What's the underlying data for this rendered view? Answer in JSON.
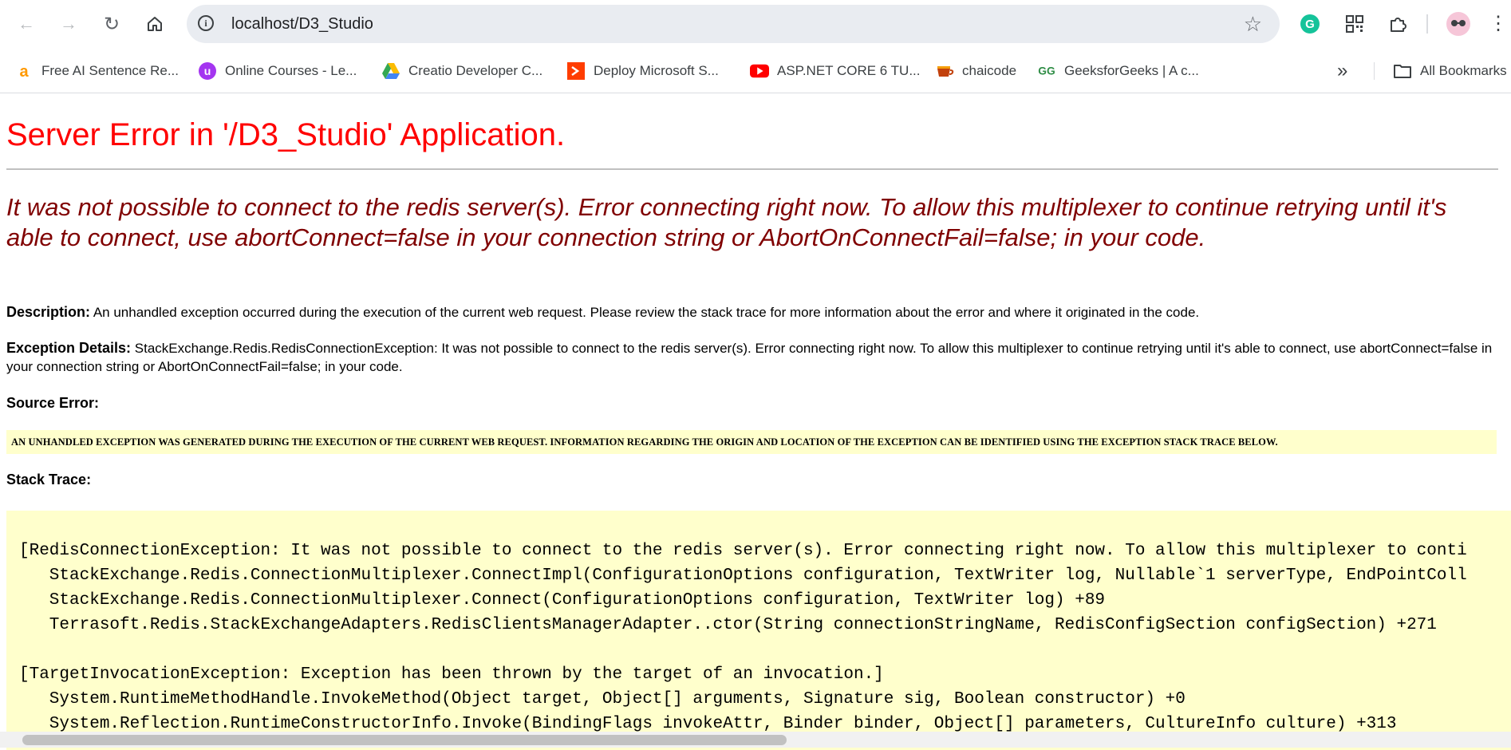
{
  "browser": {
    "url": "localhost/D3_Studio",
    "bookmarks": [
      {
        "label": "Free AI Sentence Re...",
        "icon": "ai-writer-favicon",
        "color": "#ff9900"
      },
      {
        "label": "Online Courses - Le...",
        "icon": "udemy-favicon",
        "color": "#a435f0"
      },
      {
        "label": "Creatio Developer C...",
        "icon": "google-drive-favicon",
        "color": "#34a853"
      },
      {
        "label": "Deploy Microsoft S...",
        "icon": "deploy-favicon",
        "color": "#ff3d00"
      },
      {
        "label": "ASP.NET CORE 6 TU...",
        "icon": "youtube-favicon",
        "color": "#ff0000"
      },
      {
        "label": "chaicode",
        "icon": "chaicode-favicon",
        "color": "#c2410c"
      },
      {
        "label": "GeeksforGeeks | A c...",
        "icon": "geeksforgeeks-favicon",
        "color": "#2f8d46"
      }
    ],
    "more_bookmarks_label": "»",
    "all_bookmarks_label": "All Bookmarks"
  },
  "page": {
    "title": "Server Error in '/D3_Studio' Application.",
    "error_message": "It was not possible to connect to the redis server(s). Error connecting right now. To allow this multiplexer to continue retrying until it's able to connect, use abortConnect=false in your connection string or AbortOnConnectFail=false; in your code.",
    "description_label": "Description:",
    "description_text": "An unhandled exception occurred during the execution of the current web request. Please review the stack trace for more information about the error and where it originated in the code.",
    "exception_label": "Exception Details:",
    "exception_text": "StackExchange.Redis.RedisConnectionException: It was not possible to connect to the redis server(s). Error connecting right now. To allow this multiplexer to continue retrying until it's able to connect, use abortConnect=false in your connection string or AbortOnConnectFail=false; in your code.",
    "source_error_label": "Source Error:",
    "source_error_text": "AN UNHANDLED EXCEPTION WAS GENERATED DURING THE EXECUTION OF THE CURRENT WEB REQUEST. INFORMATION REGARDING THE ORIGIN AND LOCATION OF THE EXCEPTION CAN BE IDENTIFIED USING THE EXCEPTION STACK TRACE BELOW.",
    "stack_trace_label": "Stack Trace:",
    "stack_trace_lines": [
      "[RedisConnectionException: It was not possible to connect to the redis server(s). Error connecting right now. To allow this multiplexer to conti",
      "   StackExchange.Redis.ConnectionMultiplexer.ConnectImpl(ConfigurationOptions configuration, TextWriter log, Nullable`1 serverType, EndPointColl",
      "   StackExchange.Redis.ConnectionMultiplexer.Connect(ConfigurationOptions configuration, TextWriter log) +89",
      "   Terrasoft.Redis.StackExchangeAdapters.RedisClientsManagerAdapter..ctor(String connectionStringName, RedisConfigSection configSection) +271",
      "",
      "[TargetInvocationException: Exception has been thrown by the target of an invocation.]",
      "   System.RuntimeMethodHandle.InvokeMethod(Object target, Object[] arguments, Signature sig, Boolean constructor) +0",
      "   System.Reflection.RuntimeConstructorInfo.Invoke(BindingFlags invokeAttr, Binder binder, Object[] parameters, CultureInfo culture) +313"
    ]
  }
}
